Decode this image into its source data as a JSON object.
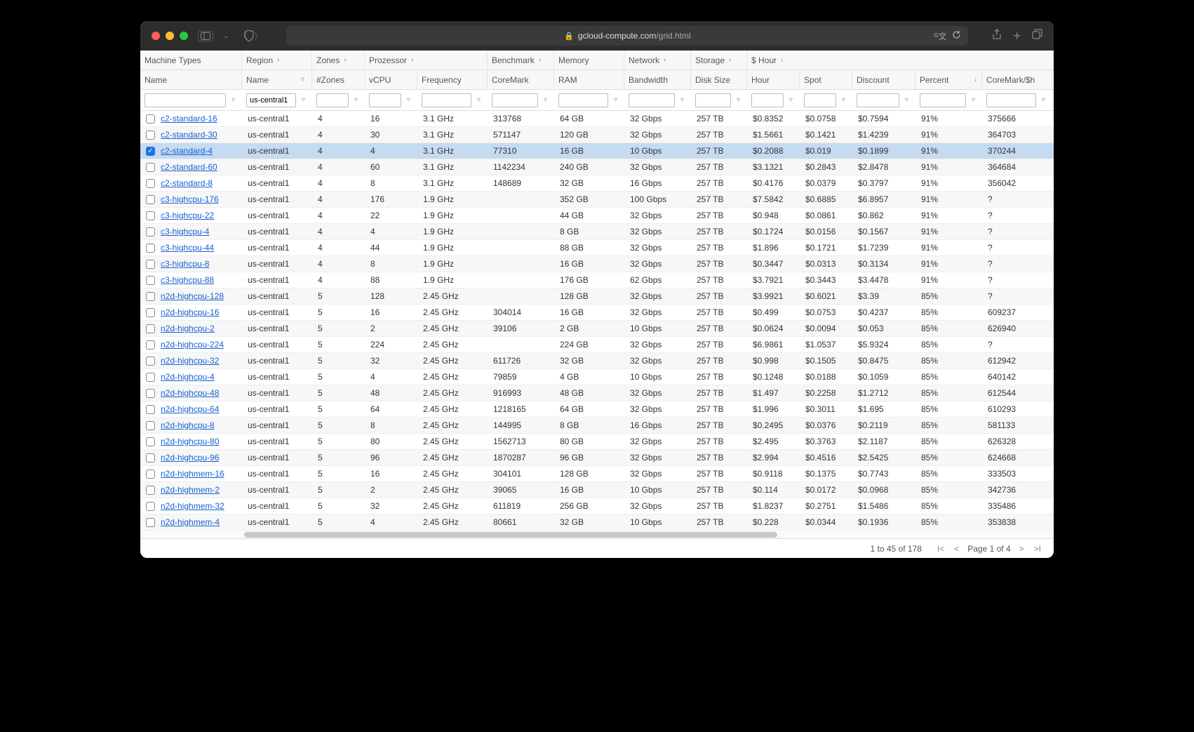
{
  "browser": {
    "url_host": "gcloud-compute.com",
    "url_path": "/grid.html"
  },
  "header_groups": [
    {
      "label": "Machine Types",
      "arrow": ""
    },
    {
      "label": "Region",
      "arrow": "›"
    },
    {
      "label": "Zones",
      "arrow": "›"
    },
    {
      "label": "Prozessor",
      "arrow": "›"
    },
    {
      "label": "Benchmark",
      "arrow": "›"
    },
    {
      "label": "Memory",
      "arrow": ""
    },
    {
      "label": "Network",
      "arrow": "›"
    },
    {
      "label": "Storage",
      "arrow": "›"
    },
    {
      "label": "$ Hour",
      "arrow": "‹"
    }
  ],
  "columns": [
    {
      "label": "Name",
      "sort": ""
    },
    {
      "label": "Name",
      "sort": "filter"
    },
    {
      "label": "#Zones",
      "sort": ""
    },
    {
      "label": "vCPU",
      "sort": ""
    },
    {
      "label": "Frequency",
      "sort": ""
    },
    {
      "label": "CoreMark",
      "sort": ""
    },
    {
      "label": "RAM",
      "sort": ""
    },
    {
      "label": "Bandwidth",
      "sort": ""
    },
    {
      "label": "Disk Size",
      "sort": ""
    },
    {
      "label": "Hour",
      "sort": ""
    },
    {
      "label": "Spot",
      "sort": ""
    },
    {
      "label": "Discount",
      "sort": ""
    },
    {
      "label": "Percent",
      "sort": "↓"
    },
    {
      "label": "CoreMark/$h",
      "sort": ""
    }
  ],
  "filter_values": {
    "region": "us-central1"
  },
  "rows": [
    {
      "selected": false,
      "name": "c2-standard-16",
      "region": "us-central1",
      "zones": "4",
      "vcpu": "16",
      "freq": "3.1 GHz",
      "coremark": "313768",
      "ram": "64 GB",
      "bw": "32 Gbps",
      "disk": "257 TB",
      "hour": "$0.8352",
      "spot": "$0.0758",
      "disc": "$0.7594",
      "pct": "91%",
      "cmh": "375666"
    },
    {
      "selected": false,
      "name": "c2-standard-30",
      "region": "us-central1",
      "zones": "4",
      "vcpu": "30",
      "freq": "3.1 GHz",
      "coremark": "571147",
      "ram": "120 GB",
      "bw": "32 Gbps",
      "disk": "257 TB",
      "hour": "$1.5661",
      "spot": "$0.1421",
      "disc": "$1.4239",
      "pct": "91%",
      "cmh": "364703"
    },
    {
      "selected": true,
      "name": "c2-standard-4",
      "region": "us-central1",
      "zones": "4",
      "vcpu": "4",
      "freq": "3.1 GHz",
      "coremark": "77310",
      "ram": "16 GB",
      "bw": "10 Gbps",
      "disk": "257 TB",
      "hour": "$0.2088",
      "spot": "$0.019",
      "disc": "$0.1899",
      "pct": "91%",
      "cmh": "370244"
    },
    {
      "selected": false,
      "name": "c2-standard-60",
      "region": "us-central1",
      "zones": "4",
      "vcpu": "60",
      "freq": "3.1 GHz",
      "coremark": "1142234",
      "ram": "240 GB",
      "bw": "32 Gbps",
      "disk": "257 TB",
      "hour": "$3.1321",
      "spot": "$0.2843",
      "disc": "$2.8478",
      "pct": "91%",
      "cmh": "364684"
    },
    {
      "selected": false,
      "name": "c2-standard-8",
      "region": "us-central1",
      "zones": "4",
      "vcpu": "8",
      "freq": "3.1 GHz",
      "coremark": "148689",
      "ram": "32 GB",
      "bw": "16 Gbps",
      "disk": "257 TB",
      "hour": "$0.4176",
      "spot": "$0.0379",
      "disc": "$0.3797",
      "pct": "91%",
      "cmh": "356042"
    },
    {
      "selected": false,
      "name": "c3-highcpu-176",
      "region": "us-central1",
      "zones": "4",
      "vcpu": "176",
      "freq": "1.9 GHz",
      "coremark": "",
      "ram": "352 GB",
      "bw": "100 Gbps",
      "disk": "257 TB",
      "hour": "$7.5842",
      "spot": "$0.6885",
      "disc": "$6.8957",
      "pct": "91%",
      "cmh": "?"
    },
    {
      "selected": false,
      "name": "c3-highcpu-22",
      "region": "us-central1",
      "zones": "4",
      "vcpu": "22",
      "freq": "1.9 GHz",
      "coremark": "",
      "ram": "44 GB",
      "bw": "32 Gbps",
      "disk": "257 TB",
      "hour": "$0.948",
      "spot": "$0.0861",
      "disc": "$0.862",
      "pct": "91%",
      "cmh": "?"
    },
    {
      "selected": false,
      "name": "c3-highcpu-4",
      "region": "us-central1",
      "zones": "4",
      "vcpu": "4",
      "freq": "1.9 GHz",
      "coremark": "",
      "ram": "8 GB",
      "bw": "32 Gbps",
      "disk": "257 TB",
      "hour": "$0.1724",
      "spot": "$0.0156",
      "disc": "$0.1567",
      "pct": "91%",
      "cmh": "?"
    },
    {
      "selected": false,
      "name": "c3-highcpu-44",
      "region": "us-central1",
      "zones": "4",
      "vcpu": "44",
      "freq": "1.9 GHz",
      "coremark": "",
      "ram": "88 GB",
      "bw": "32 Gbps",
      "disk": "257 TB",
      "hour": "$1.896",
      "spot": "$0.1721",
      "disc": "$1.7239",
      "pct": "91%",
      "cmh": "?"
    },
    {
      "selected": false,
      "name": "c3-highcpu-8",
      "region": "us-central1",
      "zones": "4",
      "vcpu": "8",
      "freq": "1.9 GHz",
      "coremark": "",
      "ram": "16 GB",
      "bw": "32 Gbps",
      "disk": "257 TB",
      "hour": "$0.3447",
      "spot": "$0.0313",
      "disc": "$0.3134",
      "pct": "91%",
      "cmh": "?"
    },
    {
      "selected": false,
      "name": "c3-highcpu-88",
      "region": "us-central1",
      "zones": "4",
      "vcpu": "88",
      "freq": "1.9 GHz",
      "coremark": "",
      "ram": "176 GB",
      "bw": "62 Gbps",
      "disk": "257 TB",
      "hour": "$3.7921",
      "spot": "$0.3443",
      "disc": "$3.4478",
      "pct": "91%",
      "cmh": "?"
    },
    {
      "selected": false,
      "name": "n2d-highcpu-128",
      "region": "us-central1",
      "zones": "5",
      "vcpu": "128",
      "freq": "2.45 GHz",
      "coremark": "",
      "ram": "128 GB",
      "bw": "32 Gbps",
      "disk": "257 TB",
      "hour": "$3.9921",
      "spot": "$0.6021",
      "disc": "$3.39",
      "pct": "85%",
      "cmh": "?"
    },
    {
      "selected": false,
      "name": "n2d-highcpu-16",
      "region": "us-central1",
      "zones": "5",
      "vcpu": "16",
      "freq": "2.45 GHz",
      "coremark": "304014",
      "ram": "16 GB",
      "bw": "32 Gbps",
      "disk": "257 TB",
      "hour": "$0.499",
      "spot": "$0.0753",
      "disc": "$0.4237",
      "pct": "85%",
      "cmh": "609237"
    },
    {
      "selected": false,
      "name": "n2d-highcpu-2",
      "region": "us-central1",
      "zones": "5",
      "vcpu": "2",
      "freq": "2.45 GHz",
      "coremark": "39106",
      "ram": "2 GB",
      "bw": "10 Gbps",
      "disk": "257 TB",
      "hour": "$0.0624",
      "spot": "$0.0094",
      "disc": "$0.053",
      "pct": "85%",
      "cmh": "626940"
    },
    {
      "selected": false,
      "name": "n2d-highcpu-224",
      "region": "us-central1",
      "zones": "5",
      "vcpu": "224",
      "freq": "2.45 GHz",
      "coremark": "",
      "ram": "224 GB",
      "bw": "32 Gbps",
      "disk": "257 TB",
      "hour": "$6.9861",
      "spot": "$1.0537",
      "disc": "$5.9324",
      "pct": "85%",
      "cmh": "?"
    },
    {
      "selected": false,
      "name": "n2d-highcpu-32",
      "region": "us-central1",
      "zones": "5",
      "vcpu": "32",
      "freq": "2.45 GHz",
      "coremark": "611726",
      "ram": "32 GB",
      "bw": "32 Gbps",
      "disk": "257 TB",
      "hour": "$0.998",
      "spot": "$0.1505",
      "disc": "$0.8475",
      "pct": "85%",
      "cmh": "612942"
    },
    {
      "selected": false,
      "name": "n2d-highcpu-4",
      "region": "us-central1",
      "zones": "5",
      "vcpu": "4",
      "freq": "2.45 GHz",
      "coremark": "79859",
      "ram": "4 GB",
      "bw": "10 Gbps",
      "disk": "257 TB",
      "hour": "$0.1248",
      "spot": "$0.0188",
      "disc": "$0.1059",
      "pct": "85%",
      "cmh": "640142"
    },
    {
      "selected": false,
      "name": "n2d-highcpu-48",
      "region": "us-central1",
      "zones": "5",
      "vcpu": "48",
      "freq": "2.45 GHz",
      "coremark": "916993",
      "ram": "48 GB",
      "bw": "32 Gbps",
      "disk": "257 TB",
      "hour": "$1.497",
      "spot": "$0.2258",
      "disc": "$1.2712",
      "pct": "85%",
      "cmh": "612544"
    },
    {
      "selected": false,
      "name": "n2d-highcpu-64",
      "region": "us-central1",
      "zones": "5",
      "vcpu": "64",
      "freq": "2.45 GHz",
      "coremark": "1218165",
      "ram": "64 GB",
      "bw": "32 Gbps",
      "disk": "257 TB",
      "hour": "$1.996",
      "spot": "$0.3011",
      "disc": "$1.695",
      "pct": "85%",
      "cmh": "610293"
    },
    {
      "selected": false,
      "name": "n2d-highcpu-8",
      "region": "us-central1",
      "zones": "5",
      "vcpu": "8",
      "freq": "2.45 GHz",
      "coremark": "144995",
      "ram": "8 GB",
      "bw": "16 Gbps",
      "disk": "257 TB",
      "hour": "$0.2495",
      "spot": "$0.0376",
      "disc": "$0.2119",
      "pct": "85%",
      "cmh": "581133"
    },
    {
      "selected": false,
      "name": "n2d-highcpu-80",
      "region": "us-central1",
      "zones": "5",
      "vcpu": "80",
      "freq": "2.45 GHz",
      "coremark": "1562713",
      "ram": "80 GB",
      "bw": "32 Gbps",
      "disk": "257 TB",
      "hour": "$2.495",
      "spot": "$0.3763",
      "disc": "$2.1187",
      "pct": "85%",
      "cmh": "626328"
    },
    {
      "selected": false,
      "name": "n2d-highcpu-96",
      "region": "us-central1",
      "zones": "5",
      "vcpu": "96",
      "freq": "2.45 GHz",
      "coremark": "1870287",
      "ram": "96 GB",
      "bw": "32 Gbps",
      "disk": "257 TB",
      "hour": "$2.994",
      "spot": "$0.4516",
      "disc": "$2.5425",
      "pct": "85%",
      "cmh": "624668"
    },
    {
      "selected": false,
      "name": "n2d-highmem-16",
      "region": "us-central1",
      "zones": "5",
      "vcpu": "16",
      "freq": "2.45 GHz",
      "coremark": "304101",
      "ram": "128 GB",
      "bw": "32 Gbps",
      "disk": "257 TB",
      "hour": "$0.9118",
      "spot": "$0.1375",
      "disc": "$0.7743",
      "pct": "85%",
      "cmh": "333503"
    },
    {
      "selected": false,
      "name": "n2d-highmem-2",
      "region": "us-central1",
      "zones": "5",
      "vcpu": "2",
      "freq": "2.45 GHz",
      "coremark": "39065",
      "ram": "16 GB",
      "bw": "10 Gbps",
      "disk": "257 TB",
      "hour": "$0.114",
      "spot": "$0.0172",
      "disc": "$0.0968",
      "pct": "85%",
      "cmh": "342736"
    },
    {
      "selected": false,
      "name": "n2d-highmem-32",
      "region": "us-central1",
      "zones": "5",
      "vcpu": "32",
      "freq": "2.45 GHz",
      "coremark": "611819",
      "ram": "256 GB",
      "bw": "32 Gbps",
      "disk": "257 TB",
      "hour": "$1.8237",
      "spot": "$0.2751",
      "disc": "$1.5486",
      "pct": "85%",
      "cmh": "335486"
    },
    {
      "selected": false,
      "name": "n2d-highmem-4",
      "region": "us-central1",
      "zones": "5",
      "vcpu": "4",
      "freq": "2.45 GHz",
      "coremark": "80661",
      "ram": "32 GB",
      "bw": "10 Gbps",
      "disk": "257 TB",
      "hour": "$0.228",
      "spot": "$0.0344",
      "disc": "$0.1936",
      "pct": "85%",
      "cmh": "353838"
    }
  ],
  "group_spans": {
    "g0": "c0",
    "g1": "c1",
    "g2": "c2",
    "g3h": [
      "c3",
      "c4"
    ],
    "g4": "c5",
    "g5": "c6",
    "g6": "c7",
    "g7": "c8",
    "g8h": [
      "c9",
      "c10",
      "c11",
      "c12",
      "c13"
    ]
  },
  "footer": {
    "range": "1 to 45 of 178",
    "page": "Page 1 of 4"
  }
}
